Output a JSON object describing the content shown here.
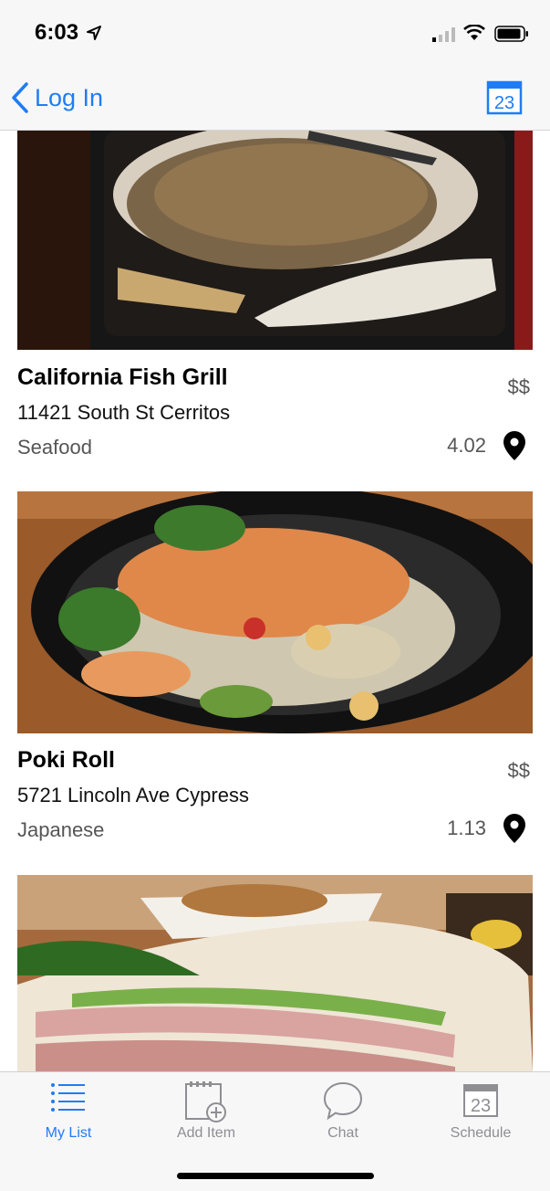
{
  "status_bar": {
    "time": "6:03"
  },
  "nav": {
    "back_label": "Log In",
    "calendar_day": "23"
  },
  "restaurants": [
    {
      "name": "California Fish Grill",
      "address": "11421 South St Cerritos",
      "category": "Seafood",
      "price": "$$",
      "distance": "4.02",
      "photo": "grilled-fish-plate"
    },
    {
      "name": "Poki Roll",
      "address": "5721 Lincoln Ave Cypress",
      "category": "Japanese",
      "price": "$$",
      "distance": "1.13",
      "photo": "poke-bowl"
    },
    {
      "photo": "sandwich"
    }
  ],
  "tabs": [
    {
      "label": "My List",
      "icon": "list-icon",
      "active": true
    },
    {
      "label": "Add Item",
      "icon": "add-item-icon",
      "active": false
    },
    {
      "label": "Chat",
      "icon": "chat-icon",
      "active": false
    },
    {
      "label": "Schedule",
      "icon": "calendar-icon",
      "active": false,
      "day": "23"
    }
  ],
  "colors": {
    "accent": "#1f7cf6",
    "tab_inactive": "#8e8e93",
    "bar_background": "#f7f7f7"
  }
}
